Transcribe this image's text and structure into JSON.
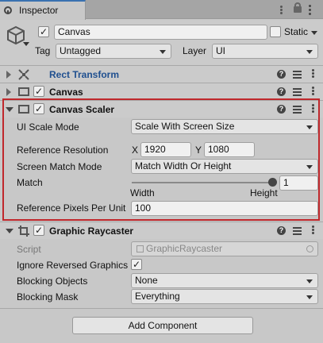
{
  "window": {
    "tab_title": "Inspector"
  },
  "gameobject": {
    "name": "Canvas",
    "active": true,
    "static_label": "Static",
    "static_checked": false,
    "tag_label": "Tag",
    "tag_value": "Untagged",
    "layer_label": "Layer",
    "layer_value": "UI"
  },
  "components": {
    "rect_transform": {
      "title": "Rect Transform"
    },
    "canvas": {
      "title": "Canvas",
      "enabled": true
    },
    "canvas_scaler": {
      "title": "Canvas Scaler",
      "enabled": true,
      "ui_scale_mode_label": "UI Scale Mode",
      "ui_scale_mode_value": "Scale With Screen Size",
      "ref_res_label": "Reference Resolution",
      "x_label": "X",
      "x_value": "1920",
      "y_label": "Y",
      "y_value": "1080",
      "match_mode_label": "Screen Match Mode",
      "match_mode_value": "Match Width Or Height",
      "match_label": "Match",
      "match_value": "1",
      "match_fraction": 1.0,
      "width_label": "Width",
      "height_label": "Height",
      "ref_ppu_label": "Reference Pixels Per Unit",
      "ref_ppu_value": "100"
    },
    "graphic_raycaster": {
      "title": "Graphic Raycaster",
      "enabled": true,
      "script_label": "Script",
      "script_value": "GraphicRaycaster",
      "ignore_reversed_label": "Ignore Reversed Graphics",
      "ignore_reversed_checked": true,
      "blocking_objects_label": "Blocking Objects",
      "blocking_objects_value": "None",
      "blocking_mask_label": "Blocking Mask",
      "blocking_mask_value": "Everything"
    }
  },
  "add_component_label": "Add Component",
  "colors": {
    "highlight": "#c0282c",
    "link_blue": "#1f4f8f",
    "tab_accent": "#3a72b0"
  }
}
